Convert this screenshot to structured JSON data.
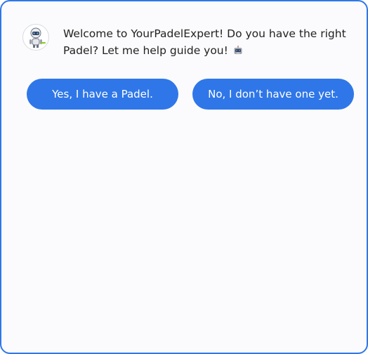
{
  "chat": {
    "message": "Welcome to YourPadelExpert! Do you have the right Padel? Let me help guide you!",
    "message_emoji": "robot-face-icon"
  },
  "options": {
    "yes_label": "Yes, I have a Padel.",
    "no_label": "No, I don’t have one yet."
  },
  "colors": {
    "accent": "#2f77e8",
    "panel_background": "#fbfbfd",
    "text": "#222222"
  }
}
